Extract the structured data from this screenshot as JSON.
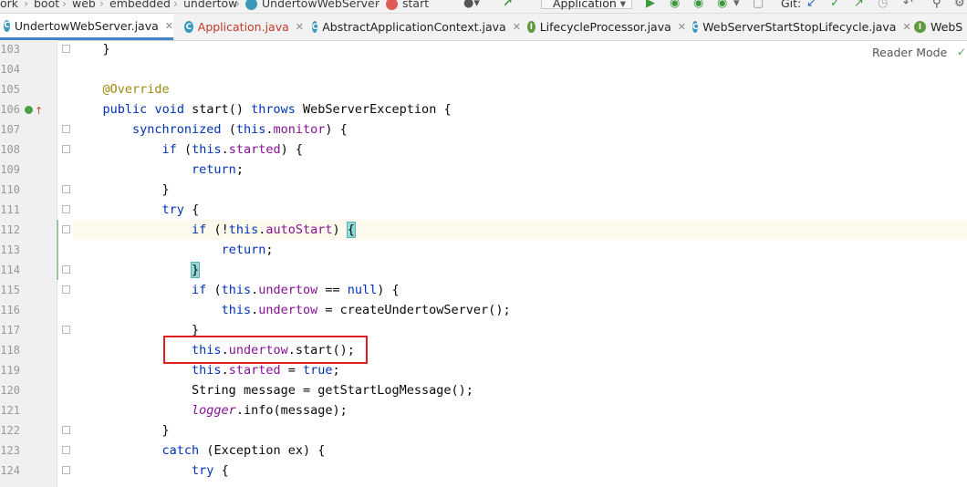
{
  "breadcrumb": {
    "items": [
      "ork",
      "boot",
      "web",
      "embedded",
      "undertow",
      "UndertowWebServer",
      "start"
    ],
    "separator": "›"
  },
  "toolbar": {
    "run_config": "Application",
    "git_label": "Git:"
  },
  "tabs": [
    {
      "label": "UndertowWebServer.java",
      "icon": "C",
      "icon_color": "#3a98ba",
      "active": true,
      "label_color": "#1f1f1f"
    },
    {
      "label": "Application.java",
      "icon": "C",
      "icon_color": "#3a98ba",
      "active": false,
      "label_color": "#c0392b"
    },
    {
      "label": "AbstractApplicationContext.java",
      "icon": "C",
      "icon_color": "#3a98ba",
      "active": false,
      "label_color": "#1f1f1f"
    },
    {
      "label": "LifecycleProcessor.java",
      "icon": "I",
      "icon_color": "#5f9a3c",
      "active": false,
      "label_color": "#1f1f1f"
    },
    {
      "label": "WebServerStartStopLifecycle.java",
      "icon": "C",
      "icon_color": "#3a98ba",
      "active": false,
      "label_color": "#1f1f1f"
    },
    {
      "label": "WebS",
      "icon": "I",
      "icon_color": "#5f9a3c",
      "active": false,
      "label_color": "#1f1f1f"
    }
  ],
  "reader_mode": "Reader Mode",
  "line_numbers": [
    "103",
    "104",
    "105",
    "106",
    "107",
    "108",
    "109",
    "110",
    "111",
    "112",
    "113",
    "114",
    "115",
    "116",
    "117",
    "118",
    "119",
    "120",
    "121",
    "122",
    "123",
    "124"
  ],
  "code": {
    "l103": "}",
    "ann": "@Override",
    "kw_public": "public",
    "kw_void": "void",
    "kw_throws": "throws",
    "kw_sync": "synchronized",
    "kw_this": "this",
    "kw_if": "if",
    "kw_return": "return",
    "kw_try": "try",
    "kw_null": "null",
    "kw_true": "true",
    "kw_catch": "catch",
    "f_monitor": "monitor",
    "f_started": "started",
    "f_autoStart": "autoStart",
    "f_undertow": "undertow",
    "f_logger": "logger",
    "p_start_sig": " start() ",
    "p_wse": " WebServerException {",
    "p_open_paren": " (",
    "p_dot": ".",
    "p_close_brace_open": ") {",
    "p_semicolon": ";",
    "p_close": "}",
    "p_open_brace": " {",
    "p_if_not": " (!",
    "p_close_paren_sp": ") ",
    "p_brace_open_match": "{",
    "p_brace_close_match": "}",
    "p_eq_eq": " == ",
    "p_assign_create": " = createUndertowServer();",
    "p_start_call": ".start();",
    "p_assign": " = ",
    "p_string_msg": "String message = getStartLogMessage();",
    "p_info": ".info(message);",
    "p_exception": " (Exception ex) {"
  }
}
